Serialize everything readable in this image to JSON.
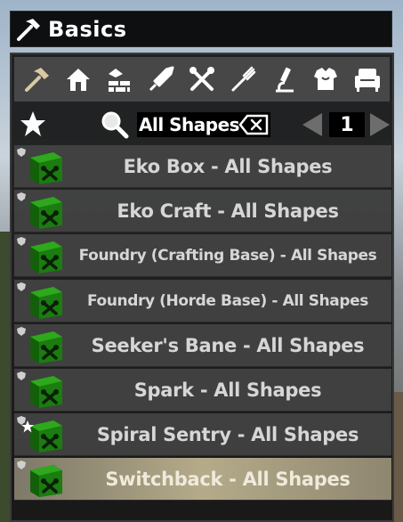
{
  "window": {
    "title": "Basics",
    "title_icon": "hammer-icon"
  },
  "categories": [
    {
      "name": "hammer-icon",
      "active": true
    },
    {
      "name": "home-icon",
      "active": false
    },
    {
      "name": "building-icon",
      "active": false
    },
    {
      "name": "weapon-icon",
      "active": false
    },
    {
      "name": "tools-icon",
      "active": false
    },
    {
      "name": "fork-icon",
      "active": false
    },
    {
      "name": "microscope-icon",
      "active": false
    },
    {
      "name": "armor-icon",
      "active": false
    },
    {
      "name": "armchair-icon",
      "active": false
    }
  ],
  "search": {
    "value": "All Shapes",
    "page": "1"
  },
  "recipes": [
    {
      "label": "Eko Box - All Shapes",
      "small": false,
      "favorite": false,
      "selected": false
    },
    {
      "label": "Eko Craft - All Shapes",
      "small": false,
      "favorite": false,
      "selected": false
    },
    {
      "label": "Foundry (Crafting Base) - All Shapes",
      "small": true,
      "favorite": false,
      "selected": false
    },
    {
      "label": "Foundry (Horde Base) - All Shapes",
      "small": true,
      "favorite": false,
      "selected": false
    },
    {
      "label": "Seeker's Bane - All Shapes",
      "small": false,
      "favorite": false,
      "selected": false
    },
    {
      "label": "Spark - All Shapes",
      "small": false,
      "favorite": false,
      "selected": false
    },
    {
      "label": "Spiral Sentry - All Shapes",
      "small": false,
      "favorite": true,
      "selected": false
    },
    {
      "label": "Switchback - All Shapes",
      "small": false,
      "favorite": false,
      "selected": true
    }
  ],
  "colors": {
    "accent": "#d9c9a3",
    "icon_green": "#1f8a12",
    "selected_row": "#b5ab8a"
  }
}
